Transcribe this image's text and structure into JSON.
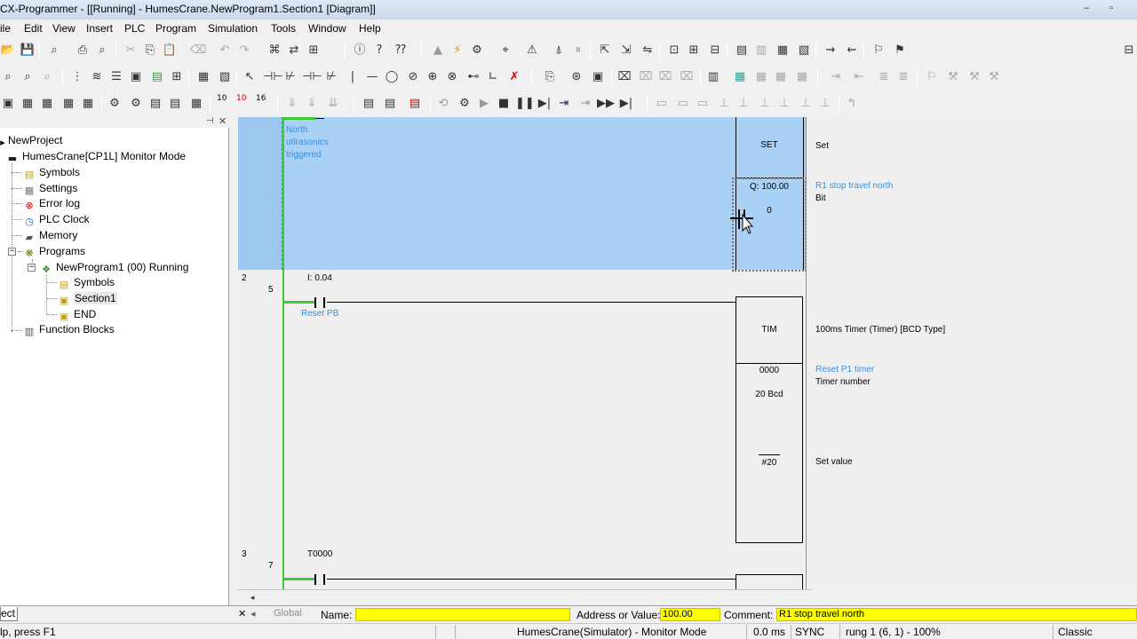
{
  "window": {
    "title": "CX-Programmer - [[Running] - HumesCrane.NewProgram1.Section1 [Diagram]]",
    "buttons": [
      "–",
      "▫"
    ]
  },
  "menu": [
    "File",
    "Edit",
    "View",
    "Insert",
    "PLC",
    "Program",
    "Simulation",
    "Tools",
    "Window",
    "Help"
  ],
  "menu_visible": [
    "ile",
    "Edit",
    "View",
    "Insert",
    "PLC",
    "Program",
    "Simulation",
    "Tools",
    "Window",
    "Help"
  ],
  "toolbar3_numbers": {
    "a": "10",
    "b": "10",
    "c": "16"
  },
  "tree": {
    "project": "NewProject",
    "plc": "HumesCrane[CP1L] Monitor Mode",
    "items": [
      "Symbols",
      "Settings",
      "Error log",
      "PLC Clock",
      "Memory",
      "Programs"
    ],
    "program": "NewProgram1 (00) Running",
    "program_items": [
      "Symbols",
      "Section1",
      "END"
    ],
    "function_blocks": "Function Blocks",
    "tab_label": "ect"
  },
  "rungs": [
    {
      "rung_no": "",
      "step": "",
      "contact_comment": "North\nutlrasonics\ntriggered",
      "instruction": "SET",
      "instruction_desc": "Set",
      "operand_addr": "Q: 100.00",
      "operand_value": "0",
      "operand_comment": "R1 stop travel north",
      "operand_desc": "Bit"
    },
    {
      "rung_no": "2",
      "step": "5",
      "contact_addr": "I: 0.04",
      "contact_comment": "Reset PB",
      "instruction": "TIM",
      "instruction_desc": "100ms Timer (Timer) [BCD Type]",
      "operand1": "0000",
      "operand1_value": "20 Bcd",
      "operand1_comment": "Reset P1 timer",
      "operand1_desc": "Timer number",
      "operand2": "#20",
      "operand2_desc": "Set value"
    },
    {
      "rung_no": "3",
      "step": "7",
      "contact_addr": "T0000"
    }
  ],
  "namebar": {
    "global_tab": "Global",
    "name_label": "Name:",
    "name_value": "",
    "address_label": "Address or Value:",
    "address_value": "100.00",
    "comment_label": "Comment:",
    "comment_value": "R1 stop travel north"
  },
  "statusbar": {
    "help": "lp, press F1",
    "connection": "HumesCrane(Simulator) - Monitor Mode",
    "scan": "0.0 ms",
    "sync": "SYNC",
    "rung": "rung 1 (6, 1) - 100%",
    "style": "Classic"
  },
  "colors": {
    "selection": "#a9d1f5",
    "power_rail": "#3cc93c",
    "comment_blue": "#3a8fe0",
    "field_yellow": "#ffff00"
  }
}
